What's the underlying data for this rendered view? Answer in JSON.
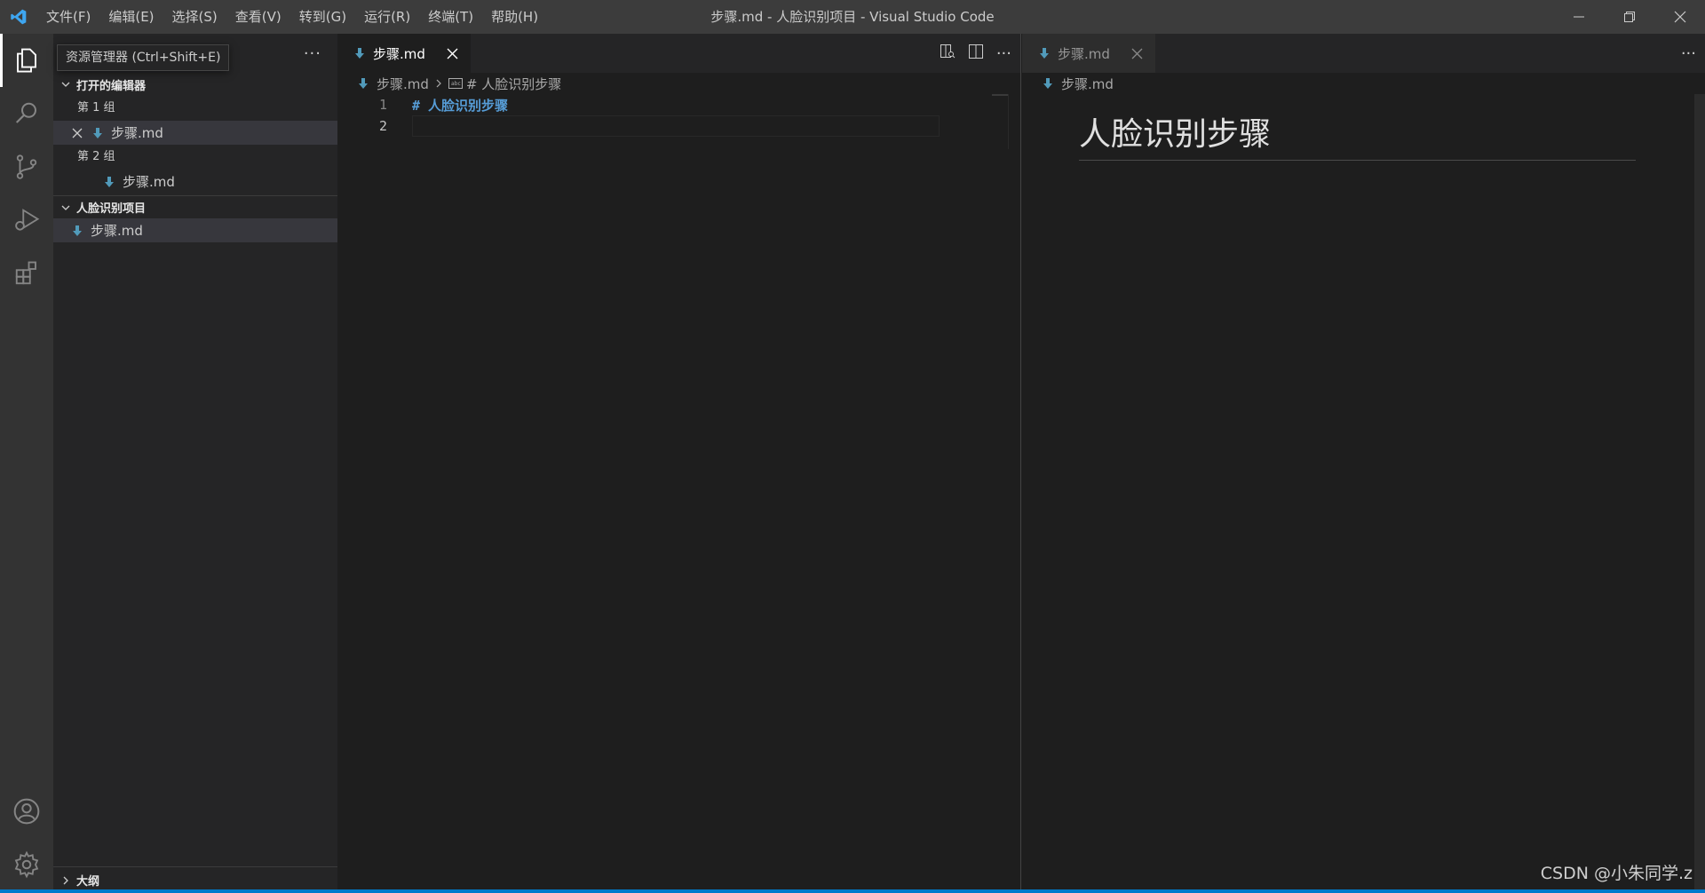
{
  "titlebar": {
    "menu": [
      "文件(F)",
      "编辑(E)",
      "选择(S)",
      "查看(V)",
      "转到(G)",
      "运行(R)",
      "终端(T)",
      "帮助(H)"
    ],
    "window_title": "步骤.md - 人脸识别项目 - Visual Studio Code"
  },
  "tooltip": "资源管理器 (Ctrl+Shift+E)",
  "sidebar": {
    "open_editors_title": "打开的编辑器",
    "group1_label": "第 1 组",
    "group1_file": "步骤.md",
    "group2_label": "第 2 组",
    "group2_file": "步骤.md",
    "project_title": "人脸识别项目",
    "project_file": "步骤.md",
    "outline_title": "大纲",
    "more": "···"
  },
  "editor": {
    "tab_label": "步骤.md",
    "breadcrumb_file": "步骤.md",
    "breadcrumb_symbol": "# 人脸识别步骤",
    "lines": [
      {
        "num": "1",
        "text": "# 人脸识别步骤"
      },
      {
        "num": "2",
        "text": ""
      }
    ]
  },
  "preview": {
    "tab_label": "步骤.md",
    "breadcrumb_file": "步骤.md",
    "heading": "人脸识别步骤"
  },
  "watermark": "CSDN @小朱同学.z",
  "colors": {
    "accent": "#007acc",
    "md_icon": "#519aba",
    "heading_code": "#569cd6"
  }
}
